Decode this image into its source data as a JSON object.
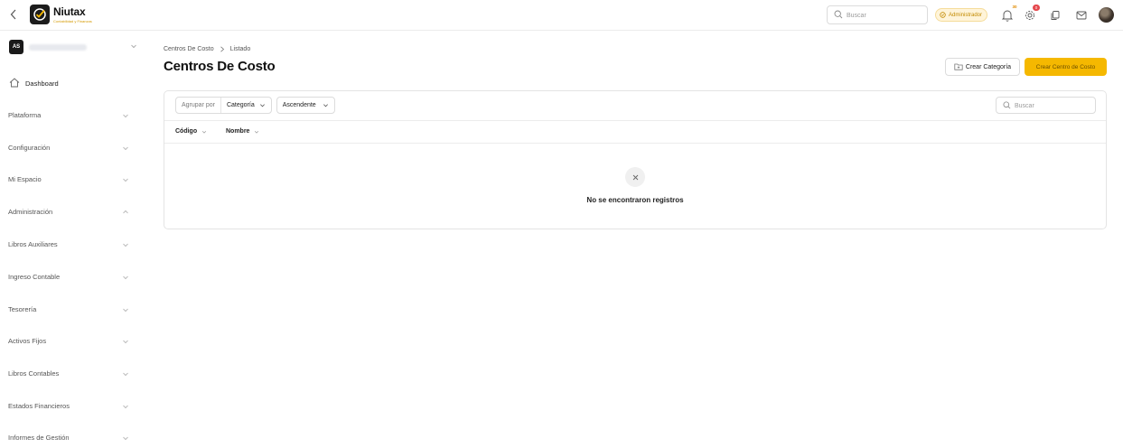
{
  "brand": {
    "name": "Niutax",
    "tagline": "Contabilidad y Finanzas"
  },
  "header": {
    "search_placeholder": "Buscar",
    "role_label": "Administrador",
    "notifications_count": "30",
    "alerts_count": "0"
  },
  "sidebar": {
    "workspace_initials": "AS",
    "dashboard_label": "Dashboard",
    "items": [
      {
        "label": "Plataforma",
        "expanded": false
      },
      {
        "label": "Configuración",
        "expanded": false
      },
      {
        "label": "Mi Espacio",
        "expanded": false
      },
      {
        "label": "Administración",
        "expanded": true
      },
      {
        "label": "Libros Auxiliares",
        "expanded": false
      },
      {
        "label": "Ingreso Contable",
        "expanded": false
      },
      {
        "label": "Tesorería",
        "expanded": false
      },
      {
        "label": "Activos Fijos",
        "expanded": false
      },
      {
        "label": "Libros Contables",
        "expanded": false
      },
      {
        "label": "Estados Financieros",
        "expanded": false
      },
      {
        "label": "Informes de Gestión",
        "expanded": false
      }
    ]
  },
  "main": {
    "breadcrumb": [
      "Centros De Costo",
      "Listado"
    ],
    "title": "Centros De Costo",
    "create_category_label": "Crear Categoría",
    "create_center_label": "Crear Centro de Costo",
    "group_by_label": "Agrupar por",
    "group_by_value": "Categoría",
    "order_value": "Ascendente",
    "search_placeholder": "Buscar",
    "columns": [
      "Código",
      "Nombre"
    ],
    "empty_message": "No se encontraron registros"
  },
  "colors": {
    "accent": "#f5b800",
    "accent_text": "#6b4f00",
    "badge_red": "#e5484d",
    "dark": "#1a1a1a"
  }
}
